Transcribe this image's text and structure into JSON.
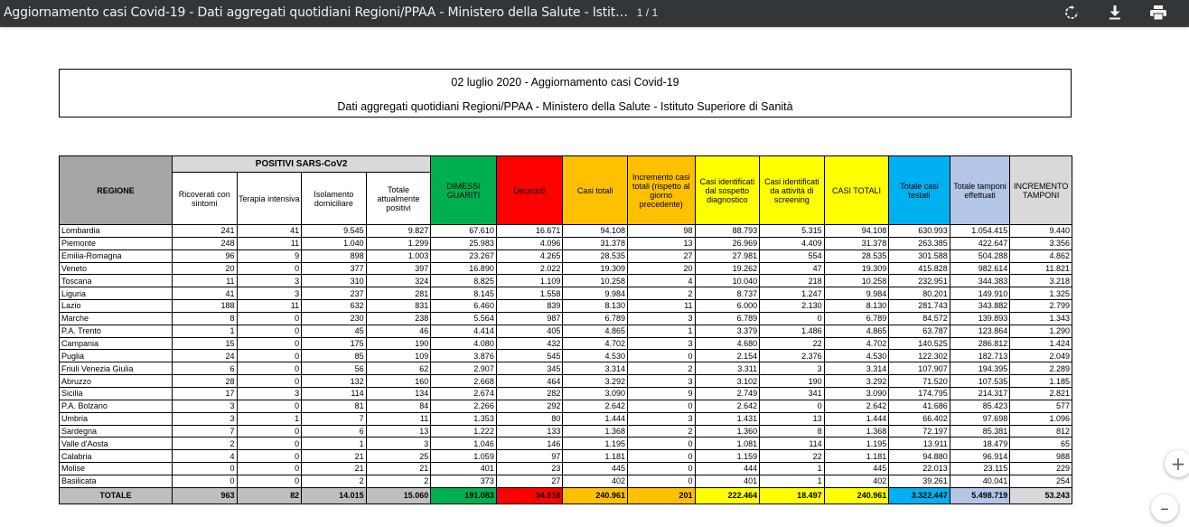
{
  "viewer": {
    "title": "Aggiornamento casi Covid-19 - Dati aggregati quotidiani Regioni/PPAA - Ministero della Salute - Istit…",
    "page_indicator": "1 / 1",
    "icons": [
      "rotate-icon",
      "download-icon",
      "print-icon"
    ],
    "zoom_in": "+",
    "zoom_out": "–"
  },
  "document": {
    "line1": "02 luglio 2020 - Aggiornamento casi Covid-19",
    "line2": "Dati aggregati quotidiani Regioni/PPAA - Ministero della Salute - Istituto Superiore di Sanità"
  },
  "table": {
    "region_header": "REGIONE",
    "group_header": "POSITIVI SARS-CoV2",
    "col_headers": [
      "Ricoverati con sintomi",
      "Terapia intensiva",
      "Isolamento domiciliare",
      "Totale attualmente positivi",
      "DIMESSI GUARITI",
      "Deceduti",
      "Casi totali",
      "Incremento casi totali (rispetto al giorno precedente)",
      "Casi identificati dal sospetto diagnostico",
      "Casi identificati da attività di screening",
      "CASI TOTALI",
      "Totale casi testati",
      "Totale tamponi effettuati",
      "INCREMENTO TAMPONI"
    ],
    "rows": [
      [
        "Lombardia",
        "241",
        "41",
        "9.545",
        "9.827",
        "67.610",
        "16.671",
        "94.108",
        "98",
        "88.793",
        "5.315",
        "94.108",
        "630.993",
        "1.054.415",
        "9.440"
      ],
      [
        "Piemonte",
        "248",
        "11",
        "1.040",
        "1.299",
        "25.983",
        "4.096",
        "31.378",
        "13",
        "26.969",
        "4.409",
        "31.378",
        "263.385",
        "422.647",
        "3.356"
      ],
      [
        "Emilia-Romagna",
        "96",
        "9",
        "898",
        "1.003",
        "23.267",
        "4.265",
        "28.535",
        "27",
        "27.981",
        "554",
        "28.535",
        "301.588",
        "504.288",
        "4.862"
      ],
      [
        "Veneto",
        "20",
        "0",
        "377",
        "397",
        "16.890",
        "2.022",
        "19.309",
        "20",
        "19.262",
        "47",
        "19.309",
        "415.828",
        "982.614",
        "11.821"
      ],
      [
        "Toscana",
        "11",
        "3",
        "310",
        "324",
        "8.825",
        "1.109",
        "10.258",
        "4",
        "10.040",
        "218",
        "10.258",
        "232.951",
        "344.383",
        "3.218"
      ],
      [
        "Liguria",
        "41",
        "3",
        "237",
        "281",
        "8.145",
        "1.558",
        "9.984",
        "2",
        "8.737",
        "1.247",
        "9.984",
        "80.201",
        "149.910",
        "1.325"
      ],
      [
        "Lazio",
        "188",
        "11",
        "632",
        "831",
        "6.460",
        "839",
        "8.130",
        "11",
        "6.000",
        "2.130",
        "8.130",
        "281.743",
        "343.882",
        "2.799"
      ],
      [
        "Marche",
        "8",
        "0",
        "230",
        "238",
        "5.564",
        "987",
        "6.789",
        "3",
        "6.789",
        "0",
        "6.789",
        "84.572",
        "139.893",
        "1.343"
      ],
      [
        "P.A. Trento",
        "1",
        "0",
        "45",
        "46",
        "4.414",
        "405",
        "4.865",
        "1",
        "3.379",
        "1.486",
        "4.865",
        "63.787",
        "123.864",
        "1.290"
      ],
      [
        "Campania",
        "15",
        "0",
        "175",
        "190",
        "4.080",
        "432",
        "4.702",
        "3",
        "4.680",
        "22",
        "4.702",
        "140.525",
        "286.812",
        "1.424"
      ],
      [
        "Puglia",
        "24",
        "0",
        "85",
        "109",
        "3.876",
        "545",
        "4.530",
        "0",
        "2.154",
        "2.376",
        "4.530",
        "122.302",
        "182.713",
        "2.049"
      ],
      [
        "Friuli Venezia Giulia",
        "6",
        "0",
        "56",
        "62",
        "2.907",
        "345",
        "3.314",
        "2",
        "3.311",
        "3",
        "3.314",
        "107.907",
        "194.395",
        "2.289"
      ],
      [
        "Abruzzo",
        "28",
        "0",
        "132",
        "160",
        "2.668",
        "464",
        "3.292",
        "3",
        "3.102",
        "190",
        "3.292",
        "71.520",
        "107.535",
        "1.185"
      ],
      [
        "Sicilia",
        "17",
        "3",
        "114",
        "134",
        "2.674",
        "282",
        "3.090",
        "9",
        "2.749",
        "341",
        "3.090",
        "174.795",
        "214.317",
        "2.821"
      ],
      [
        "P.A. Bolzano",
        "3",
        "0",
        "81",
        "84",
        "2.266",
        "292",
        "2.642",
        "0",
        "2.642",
        "0",
        "2.642",
        "41.686",
        "85.423",
        "577"
      ],
      [
        "Umbria",
        "3",
        "1",
        "7",
        "11",
        "1.353",
        "80",
        "1.444",
        "3",
        "1.431",
        "13",
        "1.444",
        "66.402",
        "97.698",
        "1.096"
      ],
      [
        "Sardegna",
        "7",
        "0",
        "6",
        "13",
        "1.222",
        "133",
        "1.368",
        "2",
        "1.360",
        "8",
        "1.368",
        "72.197",
        "85.381",
        "812"
      ],
      [
        "Valle d'Aosta",
        "2",
        "0",
        "1",
        "3",
        "1.046",
        "146",
        "1.195",
        "0",
        "1.081",
        "114",
        "1.195",
        "13.911",
        "18.479",
        "65"
      ],
      [
        "Calabria",
        "4",
        "0",
        "21",
        "25",
        "1.059",
        "97",
        "1.181",
        "0",
        "1.159",
        "22",
        "1.181",
        "94.880",
        "96.914",
        "988"
      ],
      [
        "Molise",
        "0",
        "0",
        "21",
        "21",
        "401",
        "23",
        "445",
        "0",
        "444",
        "1",
        "445",
        "22.013",
        "23.115",
        "229"
      ],
      [
        "Basilicata",
        "0",
        "0",
        "2",
        "2",
        "373",
        "27",
        "402",
        "0",
        "401",
        "1",
        "402",
        "39.261",
        "40.041",
        "254"
      ]
    ],
    "total": [
      "TOTALE",
      "963",
      "82",
      "14.015",
      "15.060",
      "191.083",
      "34.818",
      "240.961",
      "201",
      "222.464",
      "18.497",
      "240.961",
      "3.322.447",
      "5.498.719",
      "53.243"
    ]
  }
}
